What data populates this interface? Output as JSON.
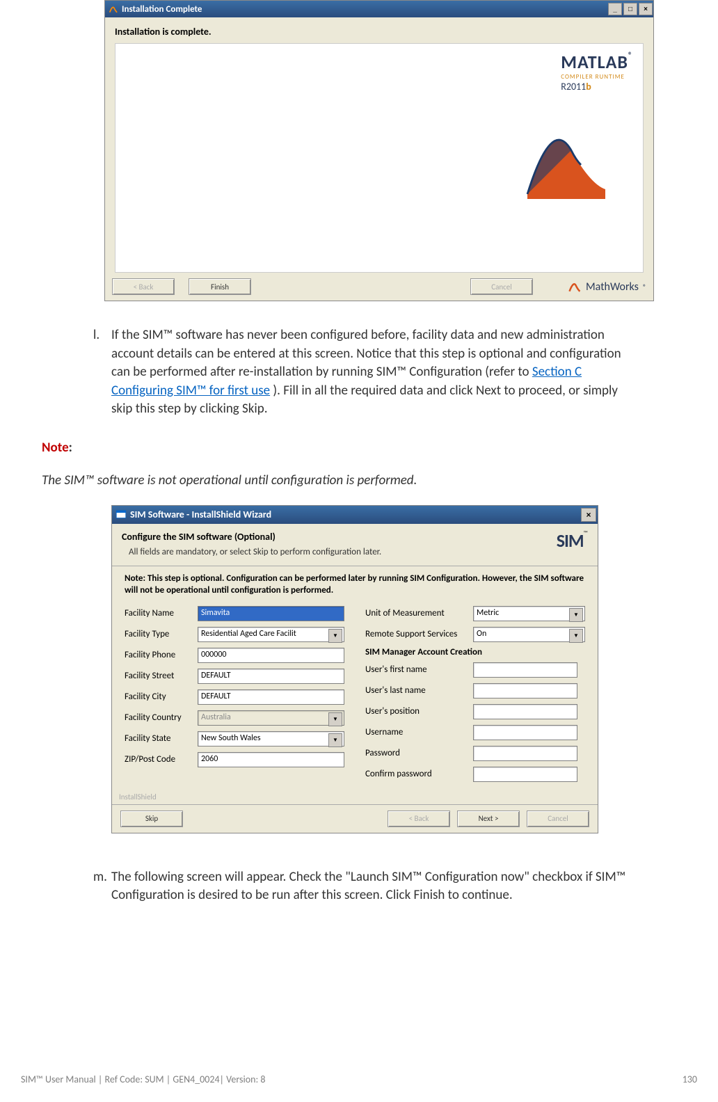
{
  "window1": {
    "title": "Installation Complete",
    "status_text": "Installation is complete.",
    "logo_name": "MATLAB",
    "logo_sub": "COMPILER RUNTIME",
    "logo_release_prefix": "R2011",
    "logo_release_suffix": "b",
    "btn_back": "< Back",
    "btn_finish": "Finish",
    "btn_cancel": "Cancel",
    "brand": "MathWorks"
  },
  "item_l": {
    "marker": "l.",
    "text_pre": "If the SIM™ software has never been configured before, facility data and new administration account details can be entered at this screen. Notice that this step is optional and configuration can be performed after re-installation by running SIM™ Configuration (refer to ",
    "link": "Section C Configuring SIM™ for first use",
    "text_post": "). Fill in all the required data and click Next to proceed, or simply skip this step by clicking Skip."
  },
  "note": {
    "label": "Note",
    "colon": ":",
    "body": "The SIM™ software is not operational until configuration is performed."
  },
  "window2": {
    "title": "SIM Software - InstallShield Wizard",
    "header_title": "Configure the SIM software (Optional)",
    "header_sub": "All fields are mandatory, or select Skip to perform configuration later.",
    "sim_logo": "SIM",
    "sim_tm": "™",
    "bold_note": "Note: This step is optional. Configuration can be performed later by running SIM Configuration. However, the SIM software will not be operational until configuration is performed.",
    "left_fields": {
      "facility_name_lbl": "Facility Name",
      "facility_name_val": "Simavita",
      "facility_type_lbl": "Facility Type",
      "facility_type_val": "Residential Aged Care Facilit",
      "facility_phone_lbl": "Facility Phone",
      "facility_phone_val": "000000",
      "facility_street_lbl": "Facility Street",
      "facility_street_val": "DEFAULT",
      "facility_city_lbl": "Facility City",
      "facility_city_val": "DEFAULT",
      "facility_country_lbl": "Facility Country",
      "facility_country_val": "Australia",
      "facility_state_lbl": "Facility State",
      "facility_state_val": "New South Wales",
      "zip_lbl": "ZIP/Post Code",
      "zip_val": "2060"
    },
    "right_fields": {
      "uom_lbl": "Unit of Measurement",
      "uom_val": "Metric",
      "rss_lbl": "Remote Support Services",
      "rss_val": "On",
      "section_hdr": "SIM Manager Account Creation",
      "first_lbl": "User's first name",
      "last_lbl": "User's last name",
      "pos_lbl": "User's position",
      "user_lbl": "Username",
      "pass_lbl": "Password",
      "conf_lbl": "Confirm password"
    },
    "brand_footer": "InstallShield",
    "btn_skip": "Skip",
    "btn_back": "< Back",
    "btn_next": "Next >",
    "btn_cancel": "Cancel"
  },
  "item_m": {
    "marker": "m.",
    "text": "The following screen will appear. Check the \"Launch SIM™ Configuration now\" checkbox if SIM™ Configuration is desired to be run after this screen. Click Finish to continue."
  },
  "footer": {
    "left": "SIM™ User Manual | Ref Code: SUM | GEN4_0024| Version: 8",
    "page": "130"
  }
}
